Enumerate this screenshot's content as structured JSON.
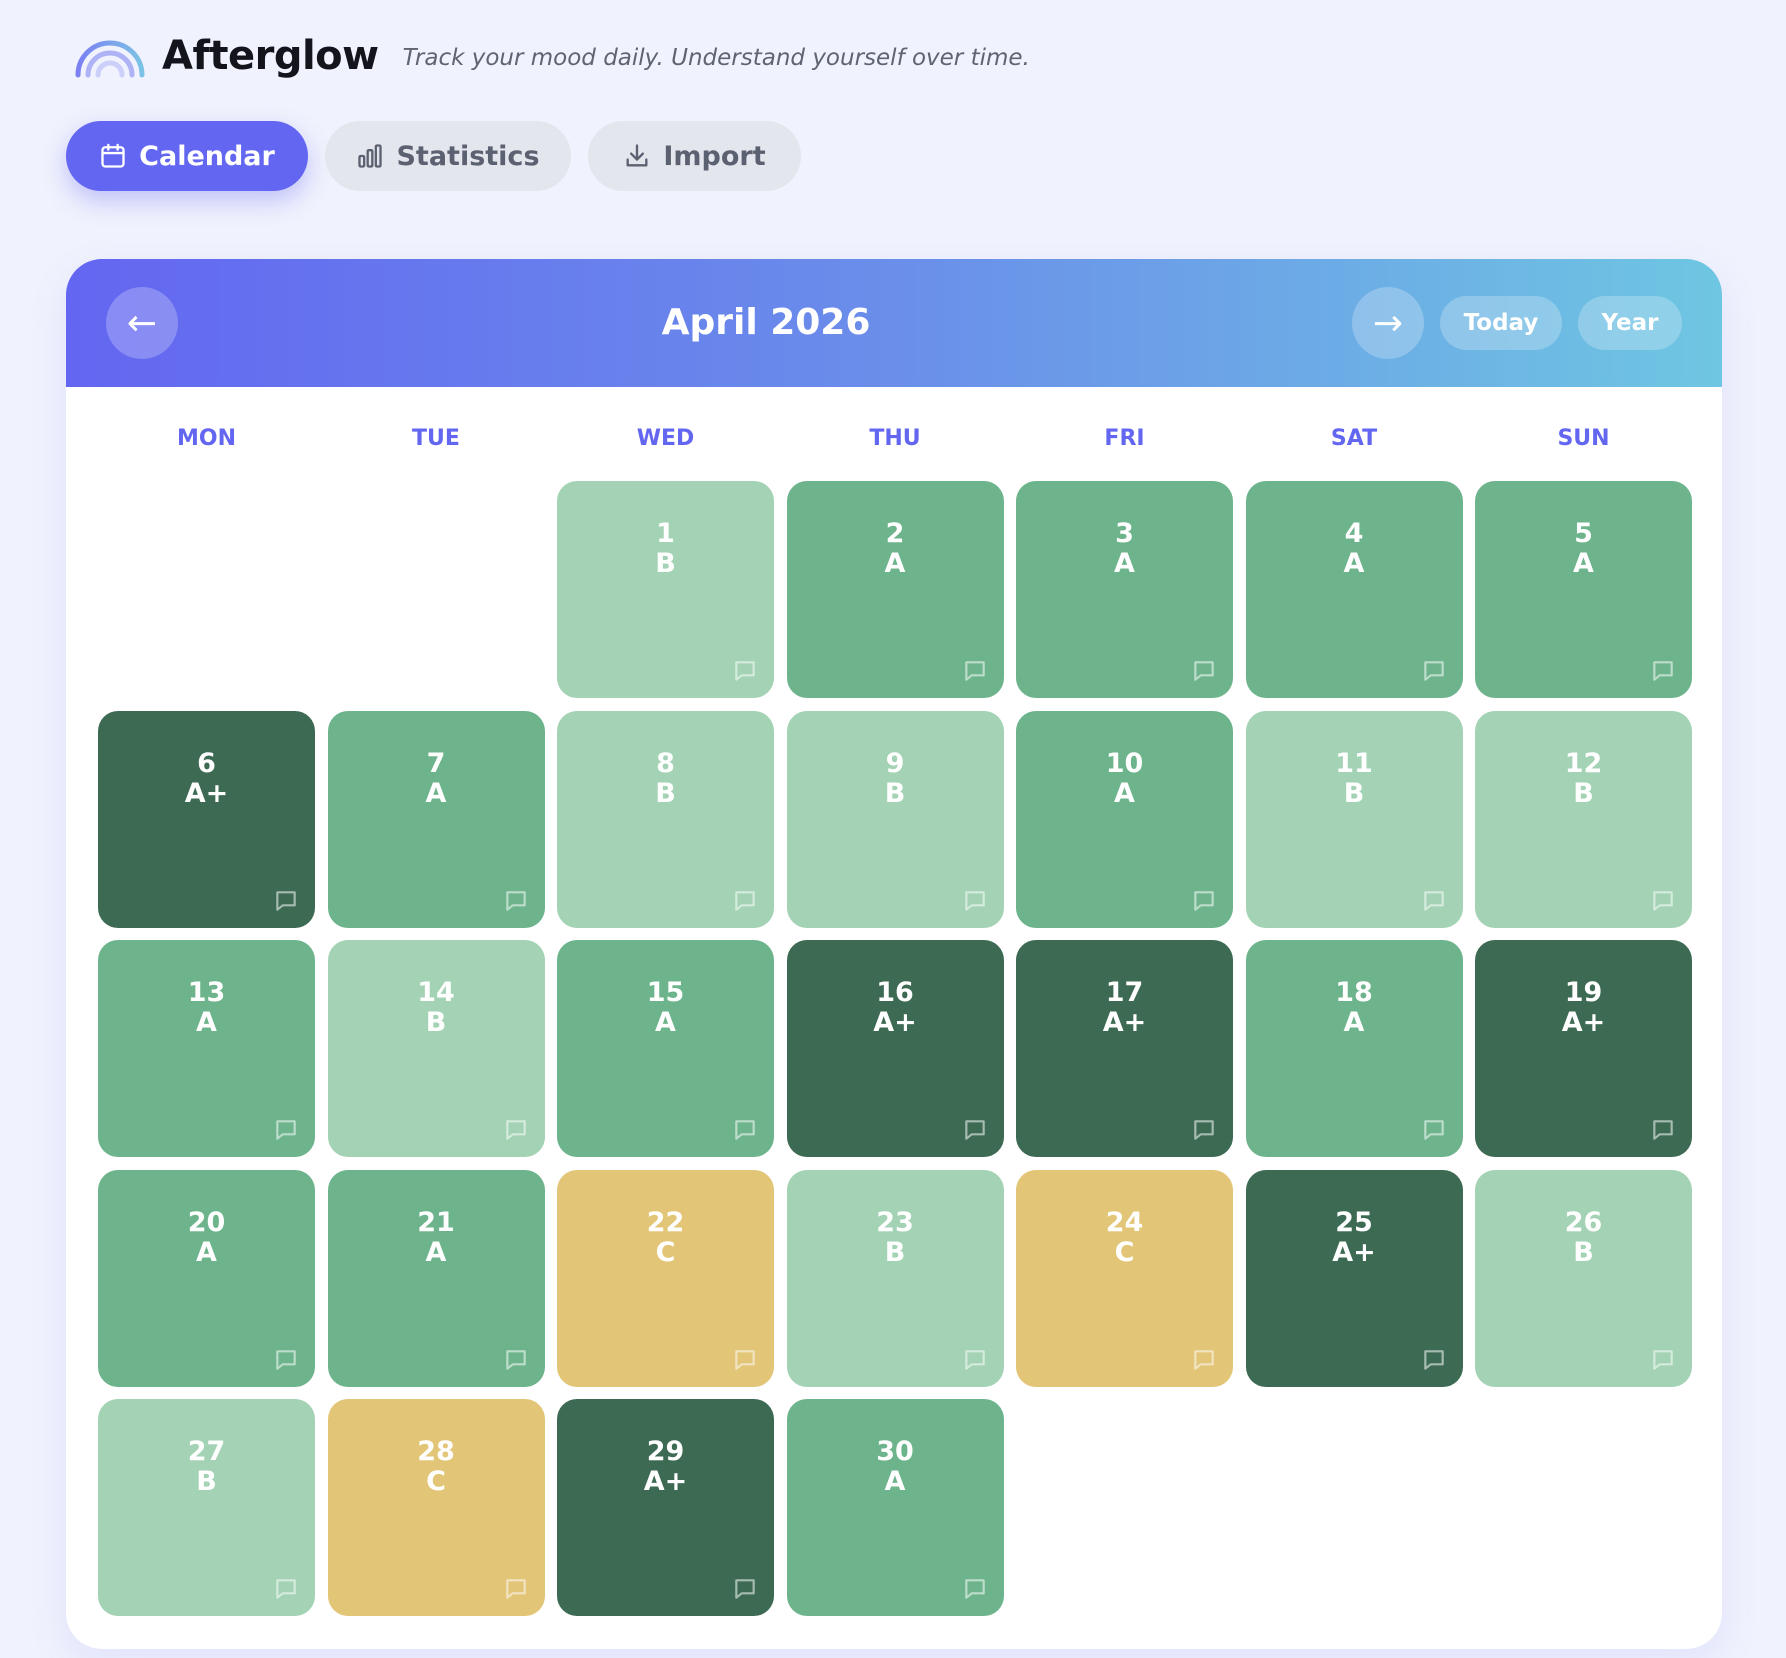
{
  "app": {
    "name": "Afterglow",
    "tagline": "Track your mood daily. Understand yourself over time."
  },
  "tabs": [
    {
      "label": "Calendar",
      "icon": "calendar-icon",
      "active": true
    },
    {
      "label": "Statistics",
      "icon": "bar-chart-icon",
      "active": false
    },
    {
      "label": "Import",
      "icon": "download-icon",
      "active": false
    }
  ],
  "calendar": {
    "title": "April 2026",
    "prev_label": "←",
    "next_label": "→",
    "today_label": "Today",
    "year_label": "Year",
    "weekdays": [
      "MON",
      "TUE",
      "WED",
      "THU",
      "FRI",
      "SAT",
      "SUN"
    ],
    "leading_blank_days": 2,
    "grade_colors": {
      "A+": "#3d6a53",
      "A": "#6db48c",
      "B": "#a3d3b4",
      "C": "#e2c577"
    },
    "days": [
      {
        "day": "1",
        "grade": "B"
      },
      {
        "day": "2",
        "grade": "A"
      },
      {
        "day": "3",
        "grade": "A"
      },
      {
        "day": "4",
        "grade": "A"
      },
      {
        "day": "5",
        "grade": "A"
      },
      {
        "day": "6",
        "grade": "A+"
      },
      {
        "day": "7",
        "grade": "A"
      },
      {
        "day": "8",
        "grade": "B"
      },
      {
        "day": "9",
        "grade": "B"
      },
      {
        "day": "10",
        "grade": "A"
      },
      {
        "day": "11",
        "grade": "B"
      },
      {
        "day": "12",
        "grade": "B"
      },
      {
        "day": "13",
        "grade": "A"
      },
      {
        "day": "14",
        "grade": "B"
      },
      {
        "day": "15",
        "grade": "A"
      },
      {
        "day": "16",
        "grade": "A+"
      },
      {
        "day": "17",
        "grade": "A+"
      },
      {
        "day": "18",
        "grade": "A"
      },
      {
        "day": "19",
        "grade": "A+"
      },
      {
        "day": "20",
        "grade": "A"
      },
      {
        "day": "21",
        "grade": "A"
      },
      {
        "day": "22",
        "grade": "C"
      },
      {
        "day": "23",
        "grade": "B"
      },
      {
        "day": "24",
        "grade": "C"
      },
      {
        "day": "25",
        "grade": "A+"
      },
      {
        "day": "26",
        "grade": "B"
      },
      {
        "day": "27",
        "grade": "B"
      },
      {
        "day": "28",
        "grade": "C"
      },
      {
        "day": "29",
        "grade": "A+"
      },
      {
        "day": "30",
        "grade": "A"
      }
    ]
  }
}
